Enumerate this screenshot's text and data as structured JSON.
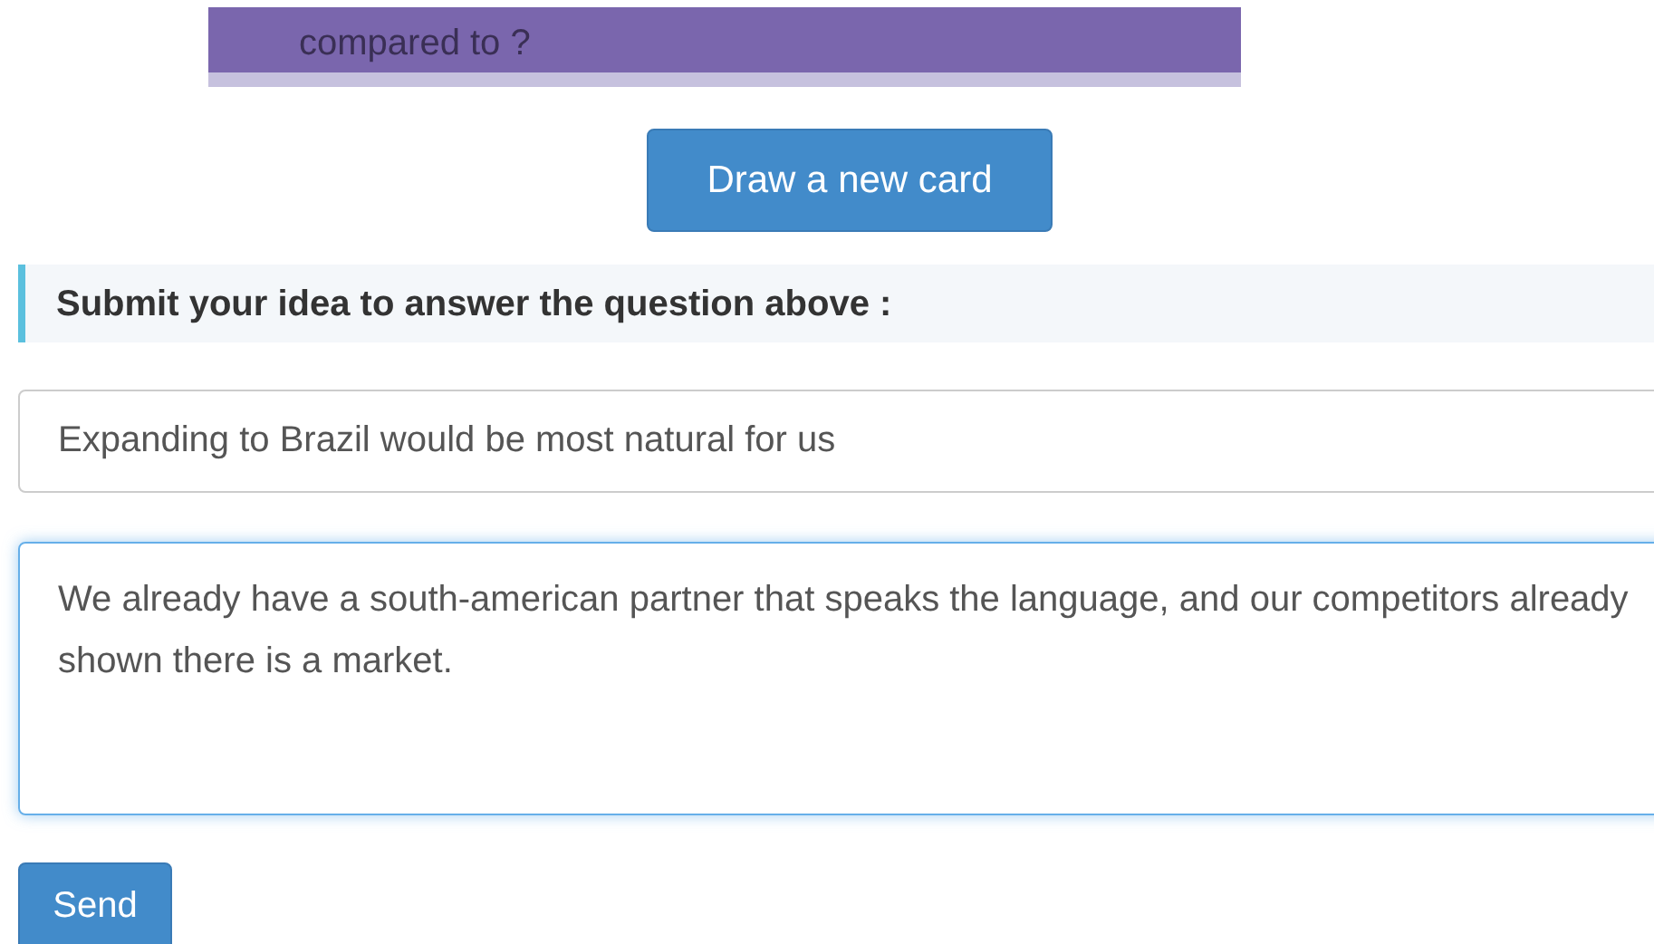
{
  "card": {
    "text": "compared to ?"
  },
  "draw_button": {
    "label": "Draw a new card"
  },
  "heading": {
    "text": "Submit your idea to answer the question above :"
  },
  "idea_field": {
    "value": "Expanding to Brazil would be most natural for us"
  },
  "explanation_field": {
    "value": "We already have a south-american partner that speaks the language, and our competitors already shown there is a market."
  },
  "send_button": {
    "label": "Send"
  }
}
